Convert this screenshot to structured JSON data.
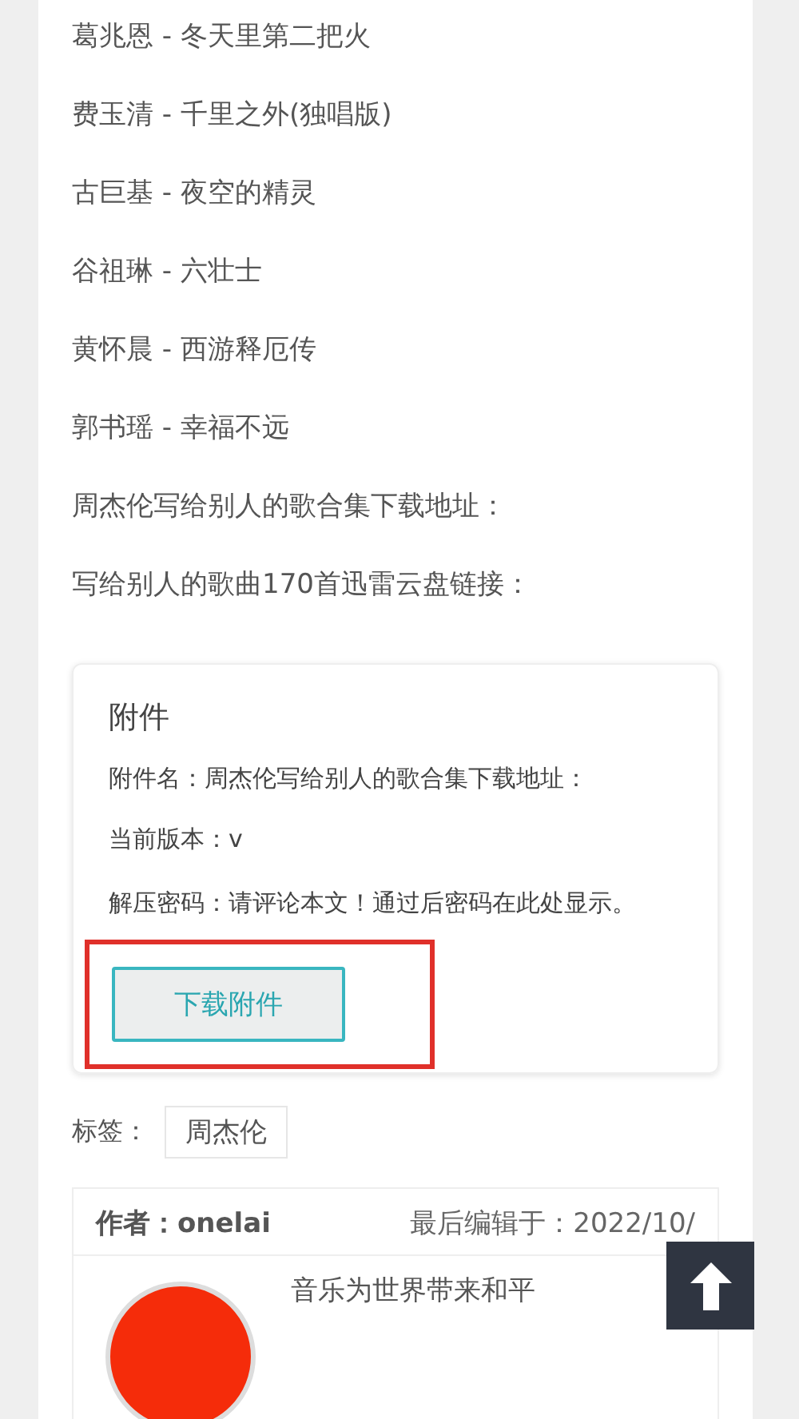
{
  "song_lines": [
    "葛兆恩 - 冬天里第二把火",
    "费玉清 - 千里之外(独唱版)",
    "古巨基 - 夜空的精灵",
    "谷祖琳 - 六壮士",
    "黄怀晨 - 西游释厄传",
    "郭书瑶 - 幸福不远",
    "周杰伦写给别人的歌合集下载地址：",
    "写给别人的歌曲170首迅雷云盘链接："
  ],
  "attachment": {
    "title": "附件",
    "lines": [
      "附件名：周杰伦写给别人的歌合集下载地址：",
      "当前版本：v",
      "解压密码：请评论本文！通过后密码在此处显示。"
    ],
    "button": "下载附件",
    "highlighted": true
  },
  "tags": {
    "label": "标签：",
    "items": [
      "周杰伦"
    ]
  },
  "author": {
    "label": "作者：",
    "name": "onelai",
    "edited": "最后编辑于：2022/10/",
    "bio": "音乐为世界带来和平"
  }
}
